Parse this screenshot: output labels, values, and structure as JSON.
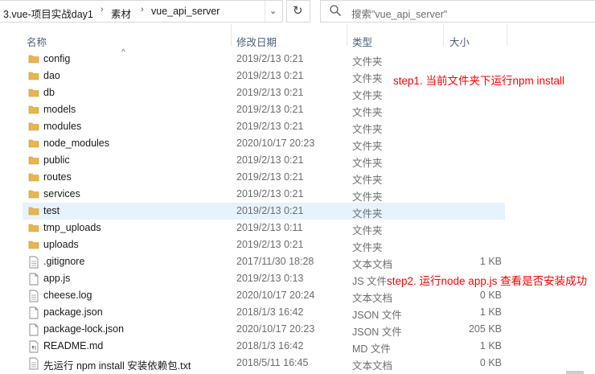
{
  "breadcrumb": {
    "items": [
      "3.vue-项目实战day1",
      "素材",
      "vue_api_server"
    ]
  },
  "search": {
    "placeholder": "搜索\"vue_api_server\""
  },
  "columns": {
    "name": "名称",
    "date": "修改日期",
    "type": "类型",
    "size": "大小"
  },
  "files": [
    {
      "name": "config",
      "date": "2019/2/13 0:21",
      "type": "文件夹",
      "size": "",
      "icon": "folder-icon"
    },
    {
      "name": "dao",
      "date": "2019/2/13 0:21",
      "type": "文件夹",
      "size": "",
      "icon": "folder-icon"
    },
    {
      "name": "db",
      "date": "2019/2/13 0:21",
      "type": "文件夹",
      "size": "",
      "icon": "folder-icon"
    },
    {
      "name": "models",
      "date": "2019/2/13 0:21",
      "type": "文件夹",
      "size": "",
      "icon": "folder-icon"
    },
    {
      "name": "modules",
      "date": "2019/2/13 0:21",
      "type": "文件夹",
      "size": "",
      "icon": "folder-icon"
    },
    {
      "name": "node_modules",
      "date": "2020/10/17 20:23",
      "type": "文件夹",
      "size": "",
      "icon": "folder-icon"
    },
    {
      "name": "public",
      "date": "2019/2/13 0:21",
      "type": "文件夹",
      "size": "",
      "icon": "folder-icon"
    },
    {
      "name": "routes",
      "date": "2019/2/13 0:21",
      "type": "文件夹",
      "size": "",
      "icon": "folder-icon"
    },
    {
      "name": "services",
      "date": "2019/2/13 0:21",
      "type": "文件夹",
      "size": "",
      "icon": "folder-icon"
    },
    {
      "name": "test",
      "date": "2019/2/13 0:21",
      "type": "文件夹",
      "size": "",
      "icon": "folder-icon",
      "selected": true
    },
    {
      "name": "tmp_uploads",
      "date": "2019/2/13 0:11",
      "type": "文件夹",
      "size": "",
      "icon": "folder-icon"
    },
    {
      "name": "uploads",
      "date": "2019/2/13 0:21",
      "type": "文件夹",
      "size": "",
      "icon": "folder-icon"
    },
    {
      "name": ".gitignore",
      "date": "2017/11/30 18:28",
      "type": "文本文档",
      "size": "1 KB",
      "icon": "text-file-icon"
    },
    {
      "name": "app.js",
      "date": "2019/2/13 0:13",
      "type": "JS 文件",
      "size": "",
      "icon": "file-icon"
    },
    {
      "name": "cheese.log",
      "date": "2020/10/17 20:24",
      "type": "文本文档",
      "size": "0 KB",
      "icon": "text-file-icon"
    },
    {
      "name": "package.json",
      "date": "2018/1/3 16:42",
      "type": "JSON 文件",
      "size": "1 KB",
      "icon": "file-icon"
    },
    {
      "name": "package-lock.json",
      "date": "2020/10/17 20:23",
      "type": "JSON 文件",
      "size": "205 KB",
      "icon": "file-icon"
    },
    {
      "name": "README.md",
      "date": "2018/1/3 16:42",
      "type": "MD 文件",
      "size": "1 KB",
      "icon": "md-file-icon"
    },
    {
      "name": "先运行 npm install 安装依赖包.txt",
      "date": "2018/5/11 16:45",
      "type": "文本文档",
      "size": "0 KB",
      "icon": "text-file-icon"
    }
  ],
  "annotations": {
    "step1": "step1. 当前文件夹下运行npm install",
    "step2": "step2. 运行node app.js 查看是否安装成功"
  },
  "colors": {
    "folder": "#e8b64c",
    "note": "#ff0000",
    "selection": "#e5f3ff"
  }
}
